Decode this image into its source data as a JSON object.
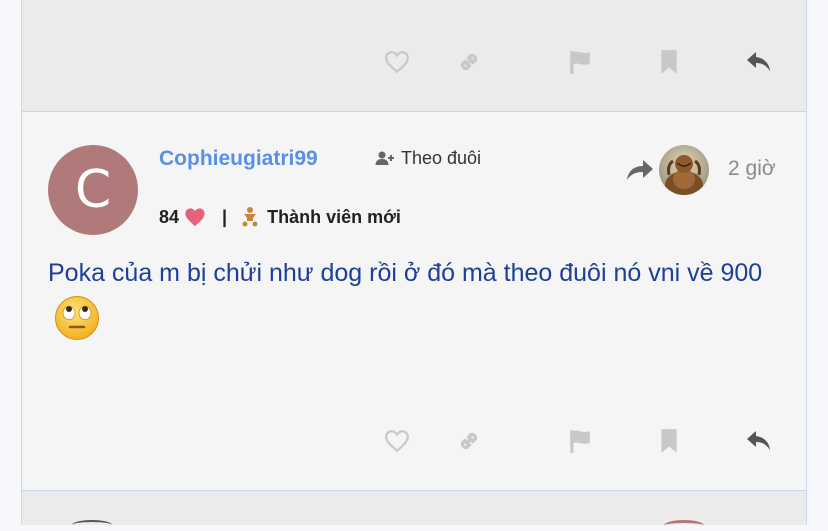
{
  "post": {
    "author": {
      "avatar_letter": "C",
      "avatar_color": "#b17a7a",
      "username": "Cophieugiatri99",
      "follow_label": "Theo đuôi",
      "reaction_count": "84",
      "separator": "|",
      "rank": "Thành viên mới"
    },
    "time": "2 giờ",
    "content": "Poka của m bị chửi như dog rồi ở đó mà theo đuôi nó vni về 900",
    "content_emoji": "face-with-rolling-eyes-emoji"
  },
  "actions": {
    "icons": [
      "heart-icon",
      "link-icon",
      "flag-icon",
      "bookmark-icon",
      "reply-icon"
    ]
  },
  "colors": {
    "username": "#5a8fe6",
    "content": "#1d3f9a",
    "heart": "#e8617a",
    "rank_icon": "#c8843a",
    "action_icon": "#c8c8c8",
    "reply_icon": "#555555"
  }
}
